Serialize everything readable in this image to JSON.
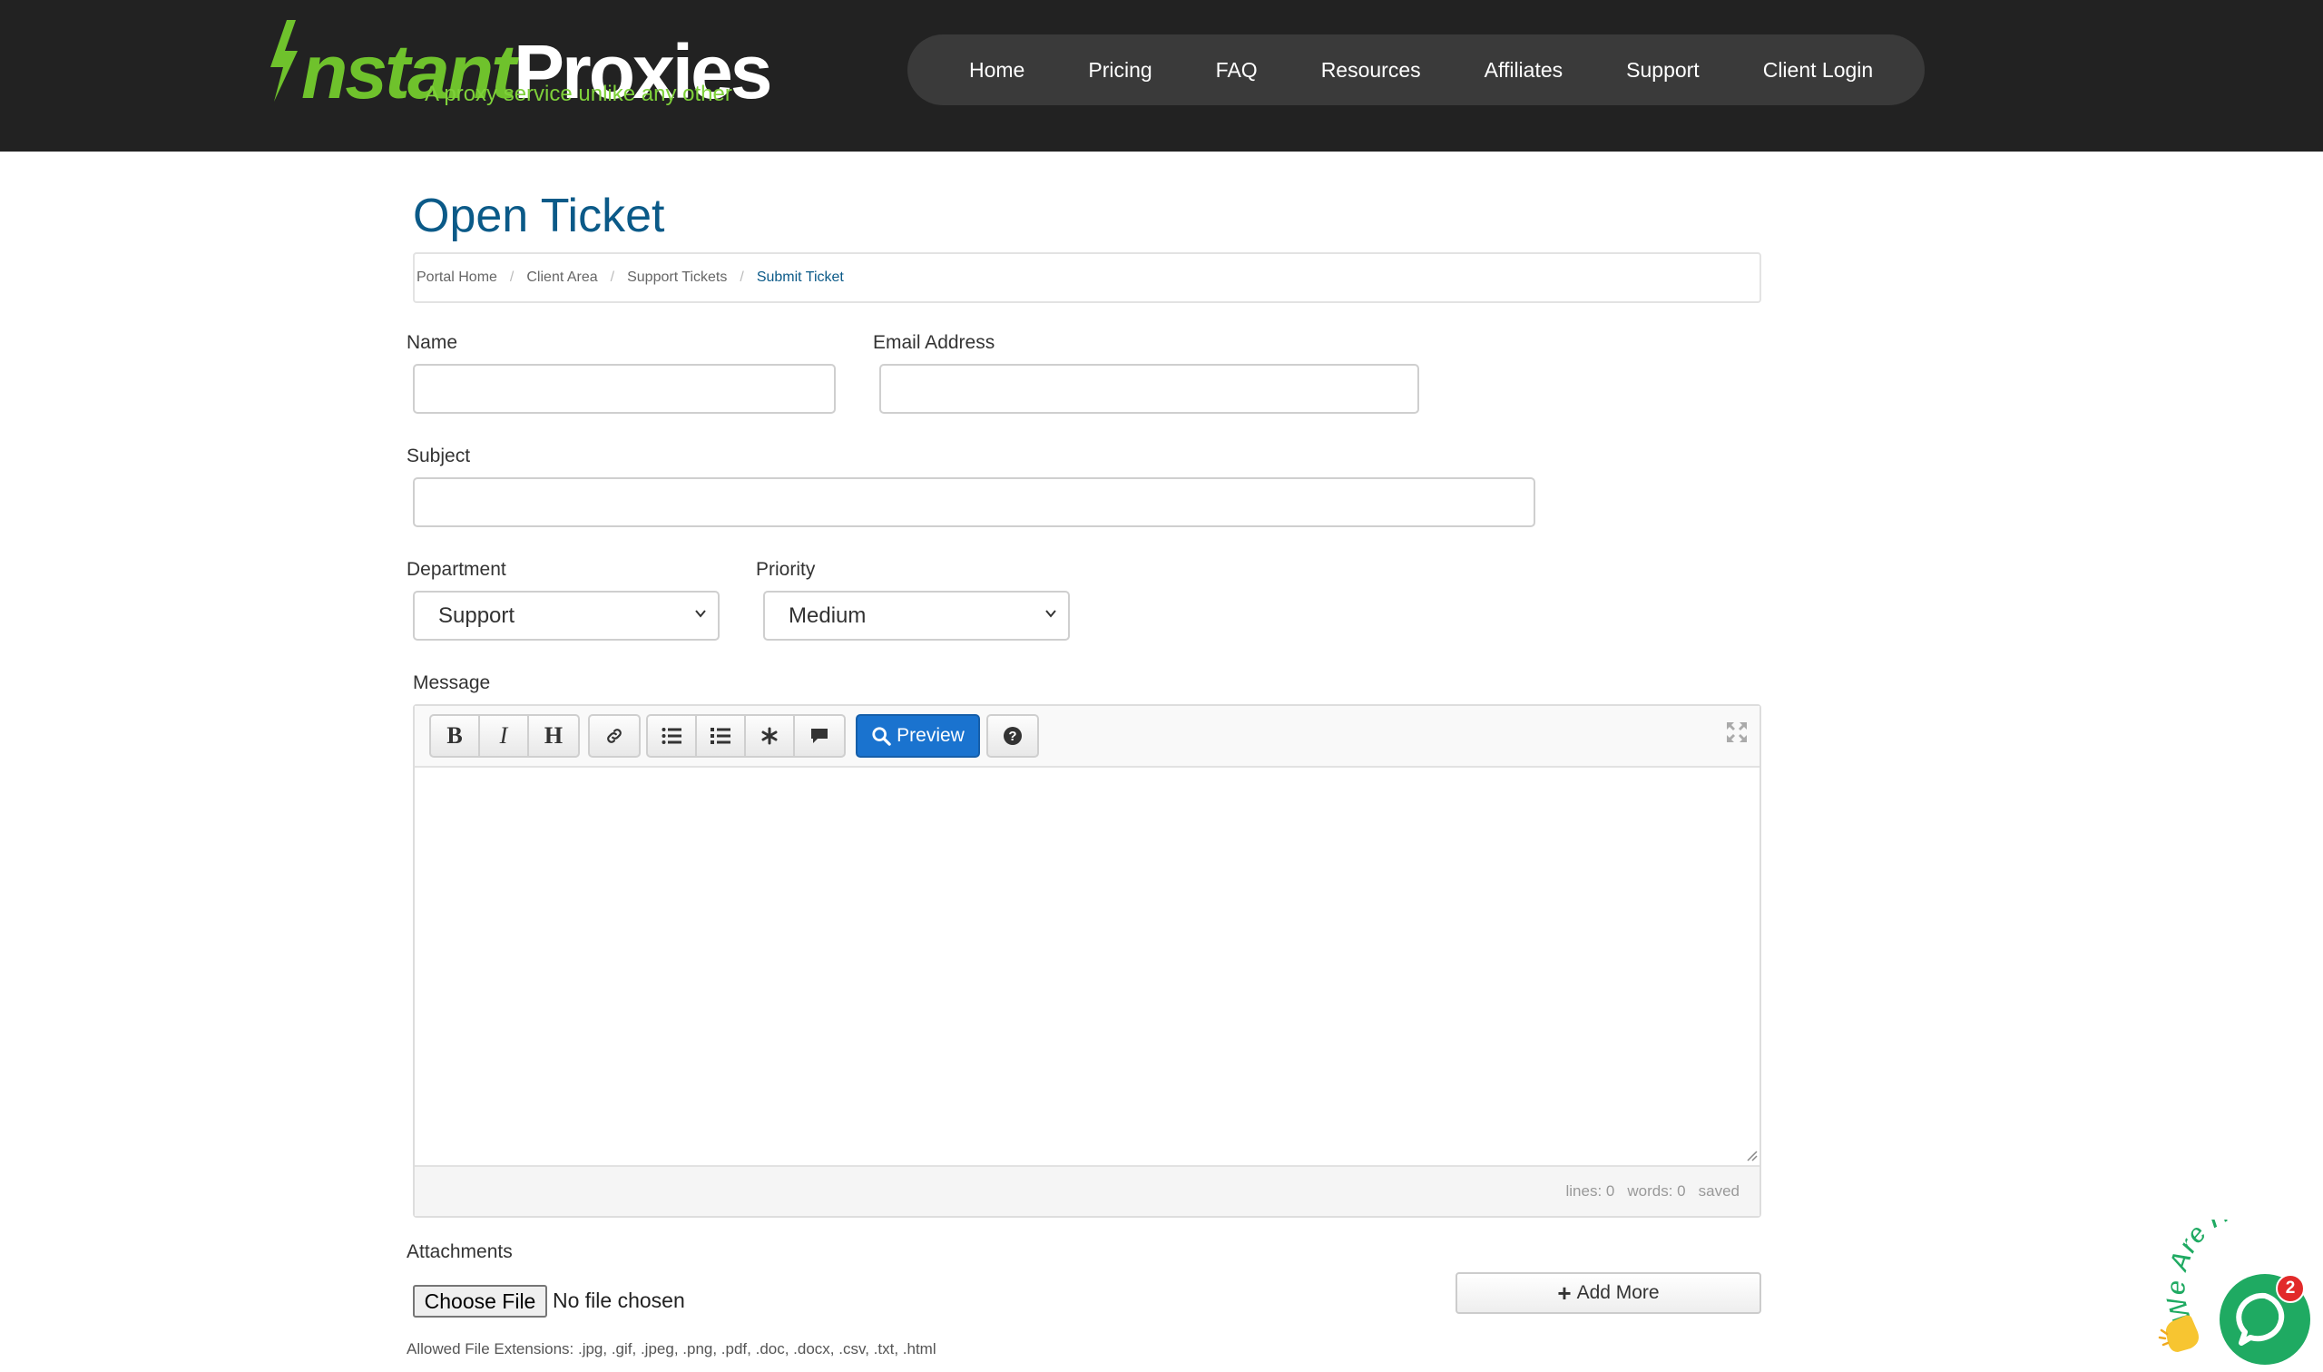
{
  "header": {
    "logo_main": "InstantProxies",
    "logo_green": "nstant",
    "logo_white": "Proxies",
    "logo_tagline": "A proxy service unlike any other",
    "nav": [
      "Home",
      "Pricing",
      "FAQ",
      "Resources",
      "Affiliates",
      "Support",
      "Client Login"
    ]
  },
  "page": {
    "title": "Open Ticket",
    "breadcrumb": [
      "Portal Home",
      "Client Area",
      "Support Tickets",
      "Submit Ticket"
    ]
  },
  "form": {
    "name_label": "Name",
    "name_value": "",
    "email_label": "Email Address",
    "email_value": "",
    "subject_label": "Subject",
    "subject_value": "",
    "department_label": "Department",
    "department_value": "Support",
    "priority_label": "Priority",
    "priority_value": "Medium",
    "message_label": "Message"
  },
  "editor": {
    "toolbar_icons": [
      "bold-icon",
      "italic-icon",
      "heading-icon",
      "link-icon",
      "unordered-list-icon",
      "ordered-list-icon",
      "asterisk-icon",
      "comment-icon",
      "question-icon",
      "fullscreen-icon"
    ],
    "bold": "B",
    "italic": "I",
    "heading": "H",
    "preview_label": "Preview",
    "status_lines": "lines: 0",
    "status_words": "words: 0",
    "status_saved": "saved"
  },
  "attachments": {
    "label": "Attachments",
    "choose_file": "Choose File",
    "no_file": "No file chosen",
    "add_more": "Add More",
    "allowed": "Allowed File Extensions: .jpg, .gif, .jpeg, .png, .pdf, .doc, .docx, .csv, .txt, .html"
  },
  "chat": {
    "arc_text": "We Are Here",
    "badge_count": "2"
  },
  "colors": {
    "header_bg": "#222222",
    "nav_bg": "#3a3a3a",
    "logo_green": "#6fc22c",
    "title_blue": "#0b5a88",
    "preview_blue": "#1a73cf",
    "chat_green": "#1faa62",
    "badge_red": "#e22a2a"
  }
}
